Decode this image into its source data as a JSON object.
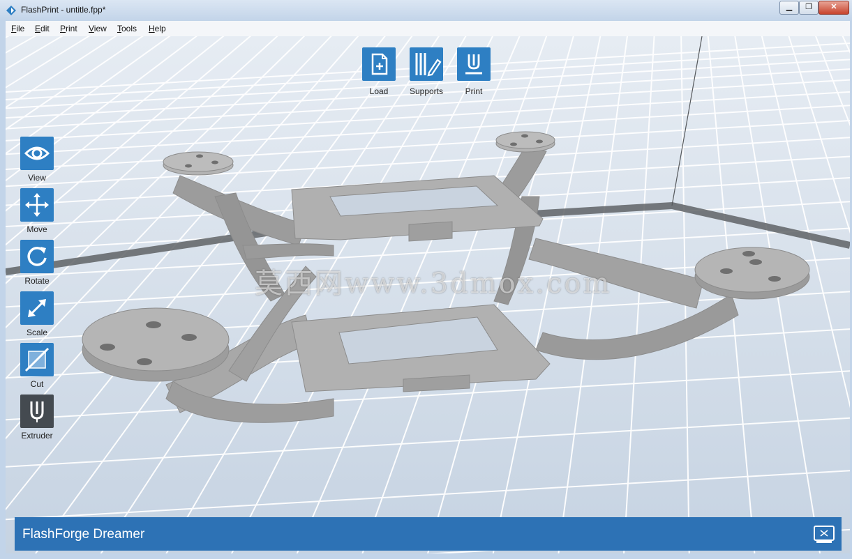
{
  "window": {
    "title": "FlashPrint - untitle.fpp*",
    "minimize_glyph": "▁",
    "maximize_glyph": "❐",
    "close_glyph": "✕"
  },
  "menu": {
    "items": [
      {
        "underline": "F",
        "rest": "ile"
      },
      {
        "underline": "E",
        "rest": "dit"
      },
      {
        "underline": "P",
        "rest": "rint"
      },
      {
        "underline": "V",
        "rest": "iew"
      },
      {
        "underline": "T",
        "rest": "ools"
      },
      {
        "underline": "H",
        "rest": "elp"
      }
    ]
  },
  "top_toolbar": {
    "load_label": "Load",
    "supports_label": "Supports",
    "print_label": "Print"
  },
  "left_toolbar": {
    "view_label": "View",
    "move_label": "Move",
    "rotate_label": "Rotate",
    "scale_label": "Scale",
    "cut_label": "Cut",
    "extruder_label": "Extruder"
  },
  "watermark": "莫西网www.3dmox.com",
  "status": {
    "printer_name": "FlashForge Dreamer"
  },
  "colors": {
    "accent": "#2e7fc3",
    "status_bar": "#2d72b5",
    "extruder_button": "#444a50",
    "model": "#a6a6a6"
  },
  "icons": {
    "load": "load-file-icon",
    "supports": "supports-icon",
    "print": "print-icon",
    "view": "eye-icon",
    "move": "move-arrows-icon",
    "rotate": "rotate-icon",
    "scale": "scale-icon",
    "cut": "cut-icon",
    "extruder": "extruder-icon",
    "printer": "printer-status-icon"
  }
}
